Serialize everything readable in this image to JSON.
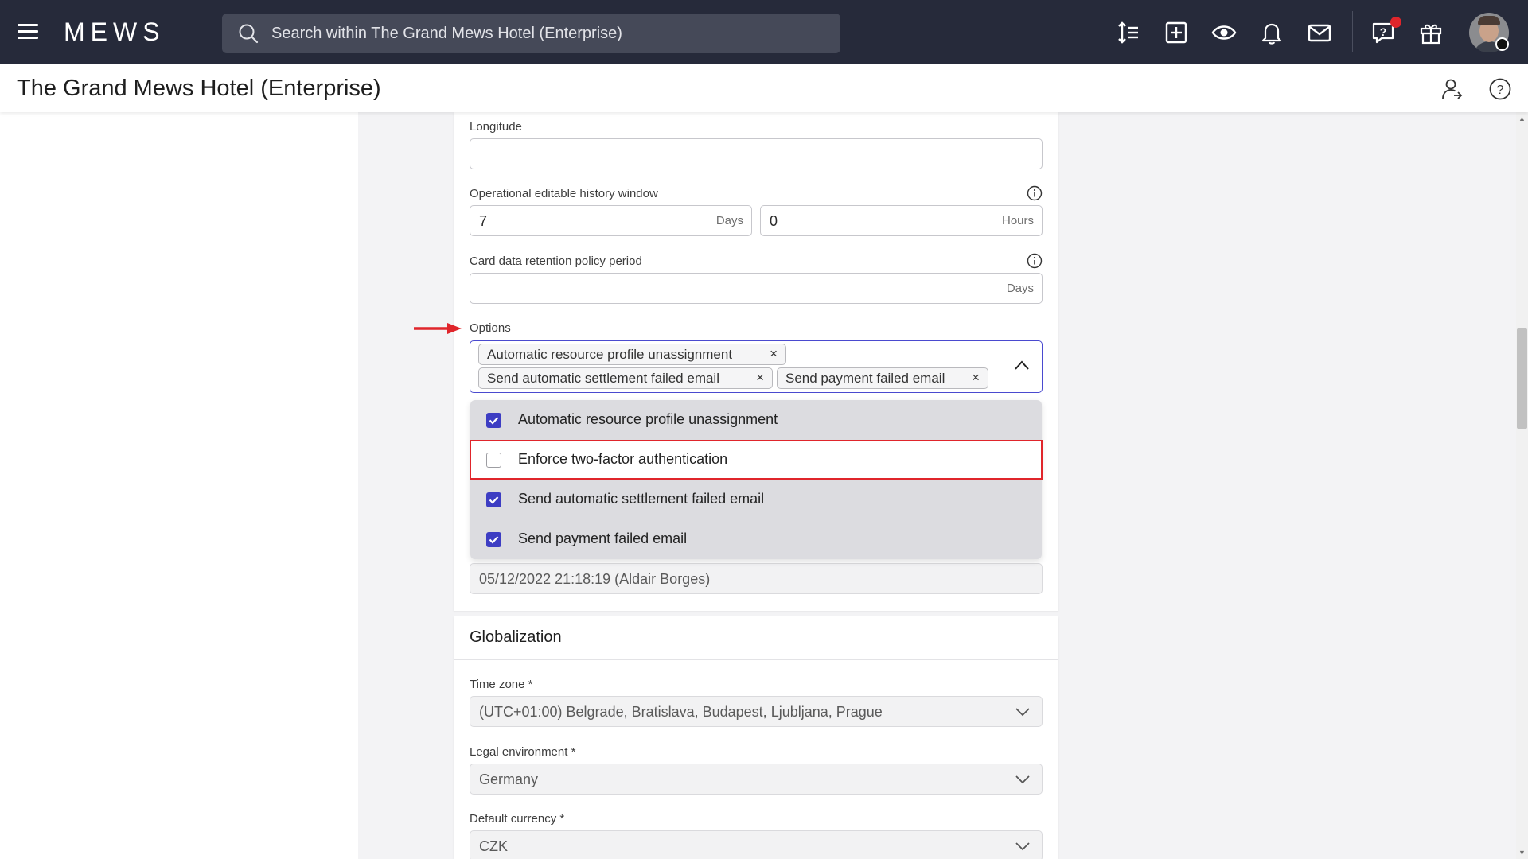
{
  "topbar": {
    "logo": "MEWS",
    "search_placeholder": "Search within The Grand Mews Hotel (Enterprise)",
    "icons": [
      "menu-icon",
      "search-icon",
      "sort-icon",
      "add-icon",
      "eye-icon",
      "bell-icon",
      "mail-icon",
      "help-chat-icon",
      "gift-icon",
      "avatar"
    ]
  },
  "header": {
    "title": "The Grand Mews Hotel (Enterprise)",
    "icons": [
      "user-switch-icon",
      "help-icon"
    ]
  },
  "form": {
    "longitude": {
      "label": "Longitude",
      "value": ""
    },
    "history_window": {
      "label": "Operational editable history window",
      "days_value": "7",
      "days_unit": "Days",
      "hours_value": "0",
      "hours_unit": "Hours"
    },
    "card_retention": {
      "label": "Card data retention policy period",
      "value": "",
      "unit": "Days"
    },
    "options": {
      "label": "Options",
      "selected_chips": [
        "Automatic resource profile unassignment",
        "Send automatic settlement failed email",
        "Send payment failed email"
      ],
      "chip_remove": "×",
      "dropdown_items": [
        {
          "label": "Automatic resource profile unassignment",
          "checked": true
        },
        {
          "label": "Enforce two-factor authentication",
          "checked": false,
          "highlighted": true
        },
        {
          "label": "Send automatic settlement failed email",
          "checked": true
        },
        {
          "label": "Send payment failed email",
          "checked": true
        }
      ]
    },
    "last_update": {
      "value": "05/12/2022 21:18:19 (Aldair Borges)"
    }
  },
  "globalization": {
    "title": "Globalization",
    "time_zone": {
      "label": "Time zone *",
      "value": "(UTC+01:00) Belgrade, Bratislava, Budapest, Ljubljana, Prague"
    },
    "legal_environment": {
      "label": "Legal environment *",
      "value": "Germany"
    },
    "default_currency": {
      "label": "Default currency *",
      "value": "CZK"
    }
  },
  "colors": {
    "topbar": "#262a3a",
    "accent": "#3d3dc3",
    "highlight_border": "#e0252b",
    "notification_dot": "#e0252b"
  }
}
